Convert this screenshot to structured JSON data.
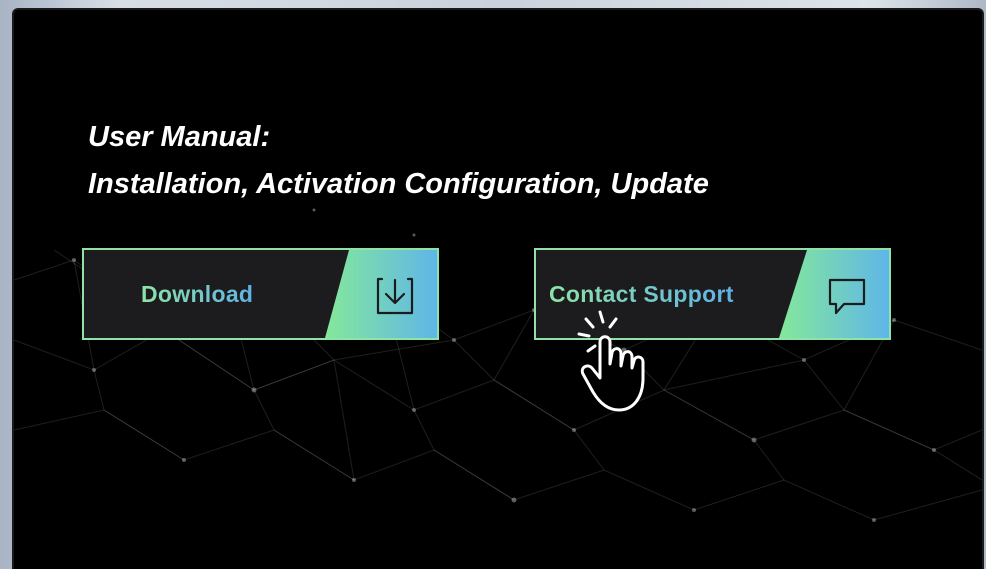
{
  "title": {
    "line1": "User Manual:",
    "line2": "Installation, Activation Configuration, Update"
  },
  "buttons": {
    "download": {
      "label": "Download",
      "icon": "download-icon"
    },
    "support": {
      "label": "Contact Support",
      "icon": "chat-bubble-icon"
    }
  },
  "cursor": {
    "icon": "hand-pointer-click-icon"
  },
  "colors": {
    "accent_green": "#84e89a",
    "accent_blue": "#5fb6e8",
    "button_bg": "#1c1c1e",
    "background": "#000000"
  }
}
